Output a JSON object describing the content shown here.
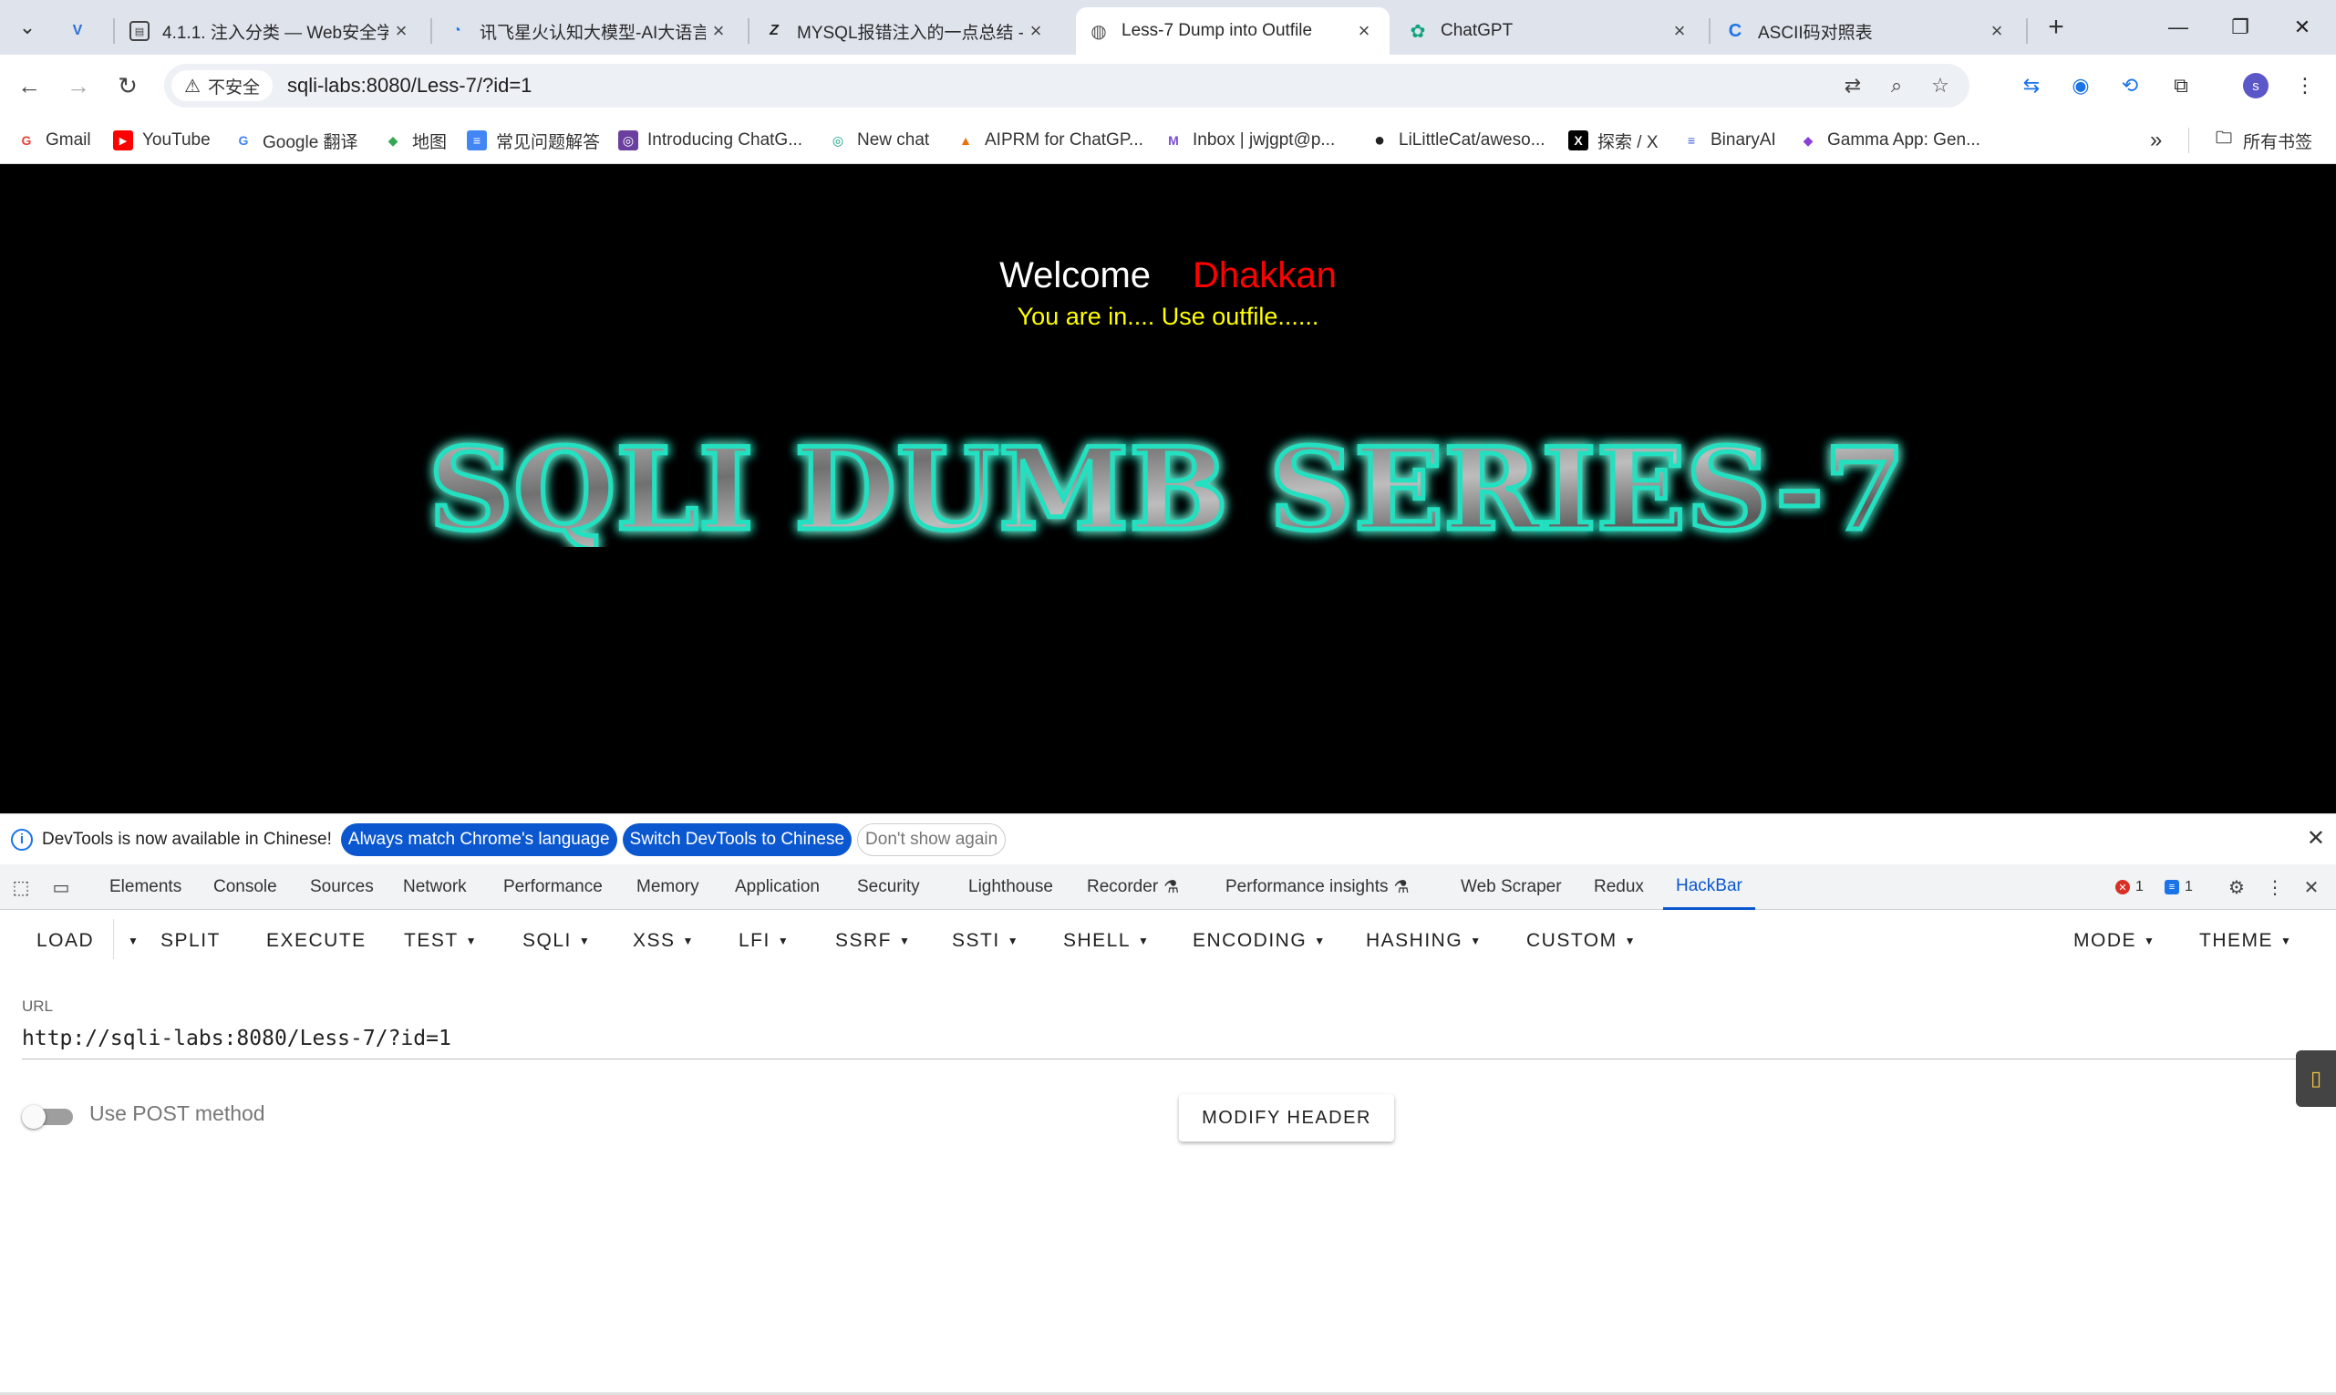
{
  "browser": {
    "tabs": [
      {
        "title": "",
        "icon": "vue-logo-icon"
      },
      {
        "title": "4.1.1. 注入分类 — Web安全学",
        "icon": "book-icon"
      },
      {
        "title": "讯飞星火认知大模型-AI大语言",
        "icon": "spark-icon"
      },
      {
        "title": "MYSQL报错注入的一点总结 -",
        "icon": "zhihu-icon"
      },
      {
        "title": "Less-7 Dump into Outfile",
        "icon": "globe-icon",
        "active": true
      },
      {
        "title": "ChatGPT",
        "icon": "chatgpt-icon"
      },
      {
        "title": "ASCII码对照表",
        "icon": "c-icon"
      }
    ],
    "security_label": "不安全",
    "url": "sqli-labs:8080/Less-7/?id=1",
    "avatar_letter": "s",
    "bookmarks": [
      {
        "label": "Gmail",
        "icon": "G",
        "color": "#ea4335"
      },
      {
        "label": "YouTube",
        "icon": "▶",
        "color": "#ff0000"
      },
      {
        "label": "Google 翻译",
        "icon": "G",
        "color": "#4285f4"
      },
      {
        "label": "地图",
        "icon": "◆",
        "color": "#34a853"
      },
      {
        "label": "常见问题解答",
        "icon": "≡",
        "color": "#4285f4"
      },
      {
        "label": "Introducing ChatG...",
        "icon": "◎",
        "color": "#6b3fa0"
      },
      {
        "label": "New chat",
        "icon": "◎",
        "color": "#10a37f"
      },
      {
        "label": "AIPRM for ChatGP...",
        "icon": "▲",
        "color": "#e8710a"
      },
      {
        "label": "Inbox | jwjgpt@p...",
        "icon": "M",
        "color": "#7b4cd6"
      },
      {
        "label": "LiLittleCat/aweso...",
        "icon": "●",
        "color": "#222"
      },
      {
        "label": "探索 / X",
        "icon": "X",
        "color": "#000"
      },
      {
        "label": "BinaryAI",
        "icon": "≡",
        "color": "#3b5bdb"
      },
      {
        "label": "Gamma App: Gen...",
        "icon": "◆",
        "color": "#8b3fd6"
      }
    ],
    "bookmarks_folder": "所有书签"
  },
  "page": {
    "welcome": "Welcome",
    "username": "Dhakkan",
    "message": "You are in.... Use outfile......",
    "banner_text": "SQLI DUMB SERIES-7"
  },
  "devtools": {
    "infobar_text": "DevTools is now available in Chinese!",
    "btn_match": "Always match Chrome's language",
    "btn_switch": "Switch DevTools to Chinese",
    "btn_dont_show": "Don't show again",
    "tabs": [
      "Elements",
      "Console",
      "Sources",
      "Network",
      "Performance",
      "Memory",
      "Application",
      "Security",
      "Lighthouse",
      "Recorder",
      "Performance insights",
      "Web Scraper",
      "Redux",
      "HackBar"
    ],
    "active_tab": "HackBar",
    "error_count": "1",
    "message_count": "1"
  },
  "hackbar": {
    "menu": [
      "LOAD",
      "SPLIT",
      "EXECUTE",
      "TEST",
      "SQLI",
      "XSS",
      "LFI",
      "SSRF",
      "SSTI",
      "SHELL",
      "ENCODING",
      "HASHING",
      "CUSTOM"
    ],
    "mode": "MODE",
    "theme": "THEME",
    "url_label": "URL",
    "url_value": "http://sqli-labs:8080/Less-7/?id=1",
    "post_label": "Use POST method",
    "modify_header": "MODIFY HEADER"
  },
  "colors": {
    "username": "#ff0000",
    "message": "#ffff00",
    "banner_glow": "#20e0c0",
    "accent": "#0b57d0"
  }
}
